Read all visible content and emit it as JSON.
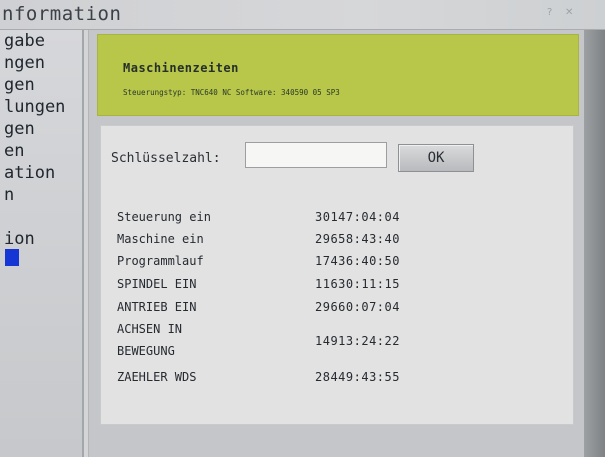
{
  "window": {
    "title": "nformation",
    "icons": [
      "help-icon",
      "close-icon"
    ]
  },
  "sidebar": {
    "items": [
      {
        "label": "gabe"
      },
      {
        "label": "ngen"
      },
      {
        "label": "gen"
      },
      {
        "label": "lungen"
      },
      {
        "label": "gen"
      },
      {
        "label": "en"
      },
      {
        "label": "ation"
      },
      {
        "label": "n"
      },
      {
        "label": ""
      },
      {
        "label": "ion"
      }
    ]
  },
  "header": {
    "title": "Maschinenzeiten",
    "subtitle": "Steuerungstyp: TNC640 NC Software: 340590 05 SP3"
  },
  "key": {
    "label": "Schlüsselzahl:",
    "value": "",
    "ok_label": "OK"
  },
  "times": [
    {
      "label": "Steuerung ein",
      "value": "30147:04:04"
    },
    {
      "label": "Maschine ein",
      "value": "29658:43:40"
    },
    {
      "label": "Programmlauf",
      "value": "17436:40:50"
    },
    {
      "label": "SPINDEL EIN",
      "value": "11630:11:15"
    },
    {
      "label": "ANTRIEB EIN",
      "value": "29660:07:04"
    },
    {
      "label_line1": "ACHSEN IN",
      "label_line2": "BEWEGUNG",
      "value": "14913:24:22"
    },
    {
      "label": "ZAEHLER WDS",
      "value": "28449:43:55"
    }
  ],
  "colors": {
    "header_green": "#b8c64a",
    "panel_bg": "#e2e2e3",
    "selection_blue": "#1536d4"
  }
}
